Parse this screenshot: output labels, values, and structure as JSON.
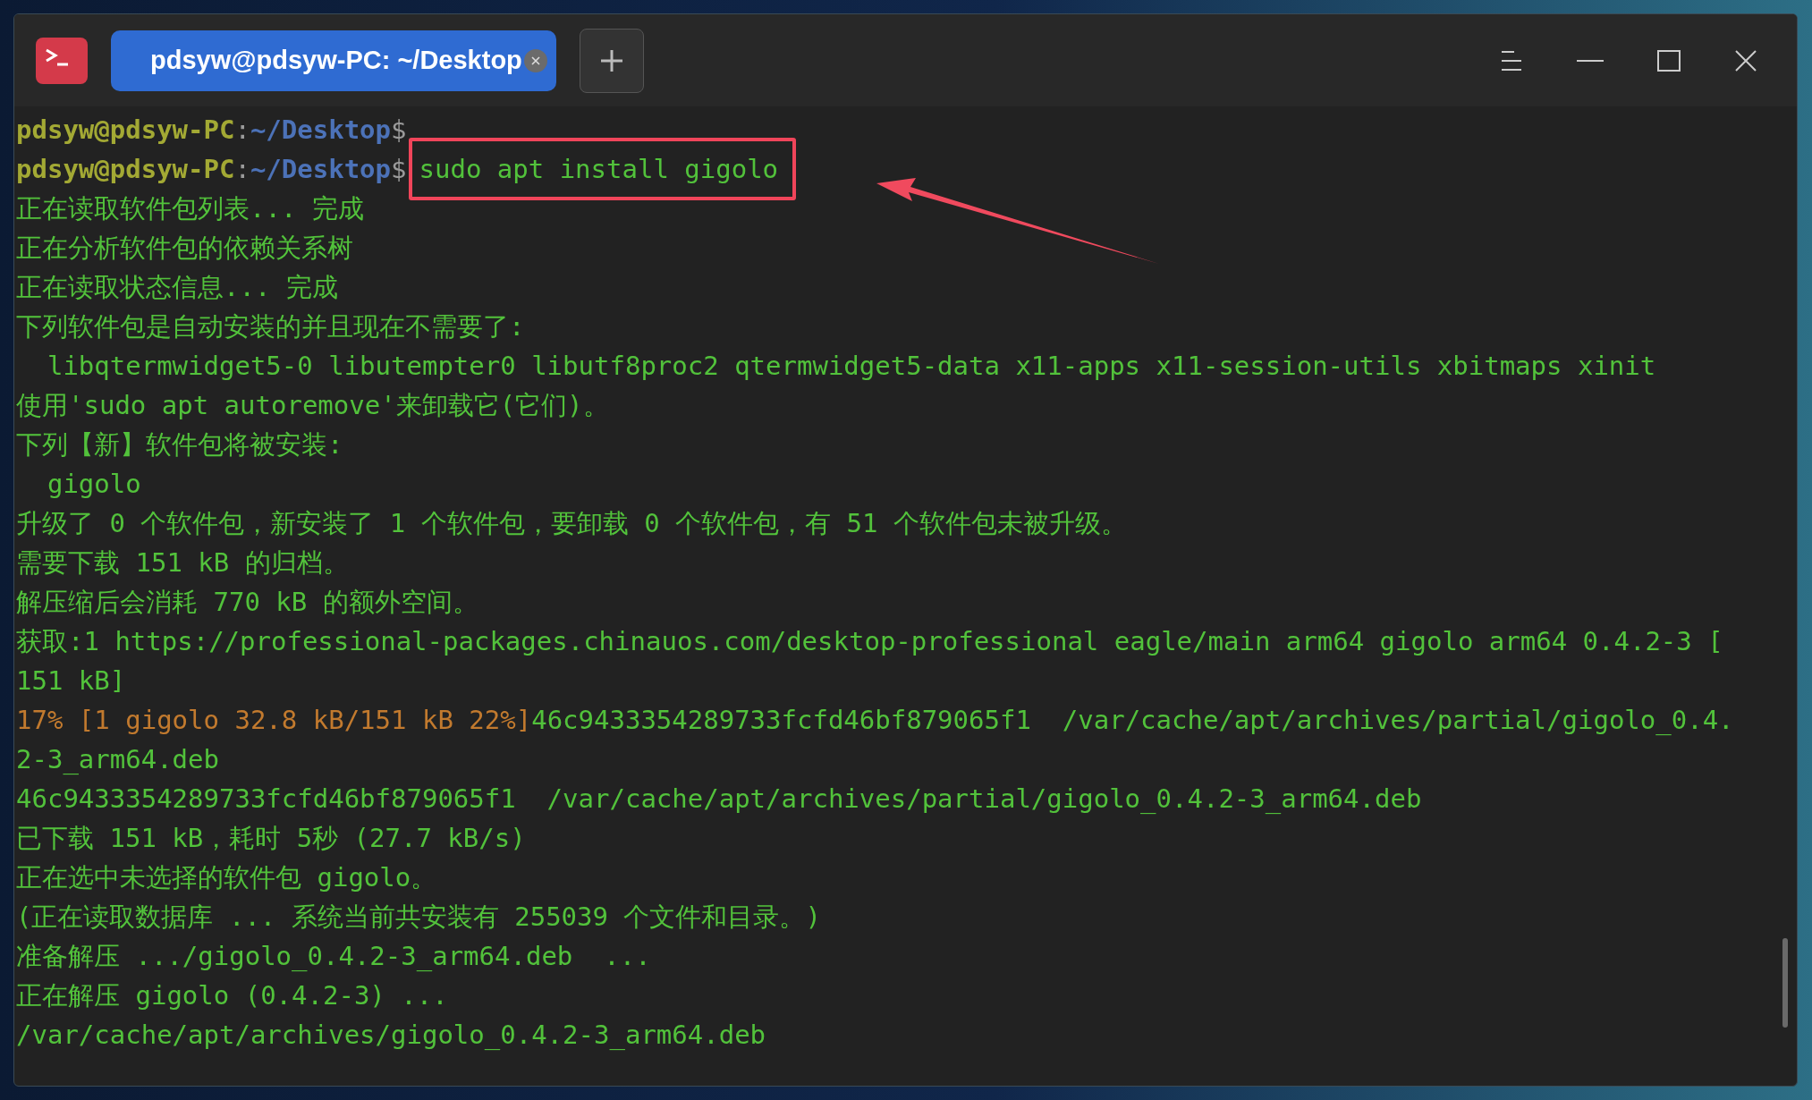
{
  "window": {
    "tabs": [
      {
        "label": "pdsyw@pdsyw-PC: ~/Desktop",
        "selected": true
      }
    ]
  },
  "terminal": {
    "lines": [
      [
        {
          "kind": "user",
          "text": "pdsyw@pdsyw-PC"
        },
        {
          "kind": "sep",
          "text": ":"
        },
        {
          "kind": "path",
          "text": "~/Desktop"
        },
        {
          "kind": "prompt",
          "text": "$"
        }
      ],
      [
        {
          "kind": "user",
          "text": "pdsyw@pdsyw-PC"
        },
        {
          "kind": "sep",
          "text": ":"
        },
        {
          "kind": "path",
          "text": "~/Desktop"
        },
        {
          "kind": "prompt",
          "text": "$"
        },
        {
          "kind": "command",
          "text": "sudo apt install gigolo",
          "highlighted": true
        }
      ],
      [
        {
          "kind": "output",
          "text": "正在读取软件包列表... 完成"
        }
      ],
      [
        {
          "kind": "output",
          "text": "正在分析软件包的依赖关系树"
        }
      ],
      [
        {
          "kind": "output",
          "text": "正在读取状态信息... 完成"
        }
      ],
      [
        {
          "kind": "output",
          "text": "下列软件包是自动安装的并且现在不需要了:"
        }
      ],
      [
        {
          "kind": "output",
          "text": "  libqtermwidget5-0 libutempter0 libutf8proc2 qtermwidget5-data x11-apps x11-session-utils xbitmaps xinit"
        }
      ],
      [
        {
          "kind": "output",
          "text": "使用'sudo apt autoremove'来卸载它(它们)。"
        }
      ],
      [
        {
          "kind": "output",
          "text": "下列【新】软件包将被安装:"
        }
      ],
      [
        {
          "kind": "output",
          "text": "  gigolo"
        }
      ],
      [
        {
          "kind": "output",
          "text": "升级了 0 个软件包，新安装了 1 个软件包，要卸载 0 个软件包，有 51 个软件包未被升级。"
        }
      ],
      [
        {
          "kind": "output",
          "text": "需要下载 151 kB 的归档。"
        }
      ],
      [
        {
          "kind": "output",
          "text": "解压缩后会消耗 770 kB 的额外空间。"
        }
      ],
      [
        {
          "kind": "output",
          "text": "获取:1 https://professional-packages.chinauos.com/desktop-professional eagle/main arm64 gigolo arm64 0.4.2-3 ["
        }
      ],
      [
        {
          "kind": "output",
          "text": "151 kB]"
        }
      ],
      [
        {
          "kind": "progress",
          "text": "17% [1 gigolo 32.8 kB/151 kB 22%]"
        },
        {
          "kind": "output",
          "text": "46c9433354289733fcfd46bf879065f1  /var/cache/apt/archives/partial/gigolo_0.4."
        }
      ],
      [
        {
          "kind": "output",
          "text": "2-3_arm64.deb"
        }
      ],
      [
        {
          "kind": "output",
          "text": "46c9433354289733fcfd46bf879065f1  /var/cache/apt/archives/partial/gigolo_0.4.2-3_arm64.deb"
        }
      ],
      [
        {
          "kind": "output",
          "text": "已下载 151 kB，耗时 5秒 (27.7 kB/s)"
        }
      ],
      [
        {
          "kind": "output",
          "text": "正在选中未选择的软件包 gigolo。"
        }
      ],
      [
        {
          "kind": "output",
          "text": "(正在读取数据库 ... 系统当前共安装有 255039 个文件和目录。)"
        }
      ],
      [
        {
          "kind": "output",
          "text": "准备解压 .../gigolo_0.4.2-3_arm64.deb  ..."
        }
      ],
      [
        {
          "kind": "output",
          "text": "正在解压 gigolo (0.4.2-3) ..."
        }
      ],
      [
        {
          "kind": "output",
          "text": "/var/cache/apt/archives/gigolo_0.4.2-3_arm64.deb"
        }
      ]
    ]
  }
}
